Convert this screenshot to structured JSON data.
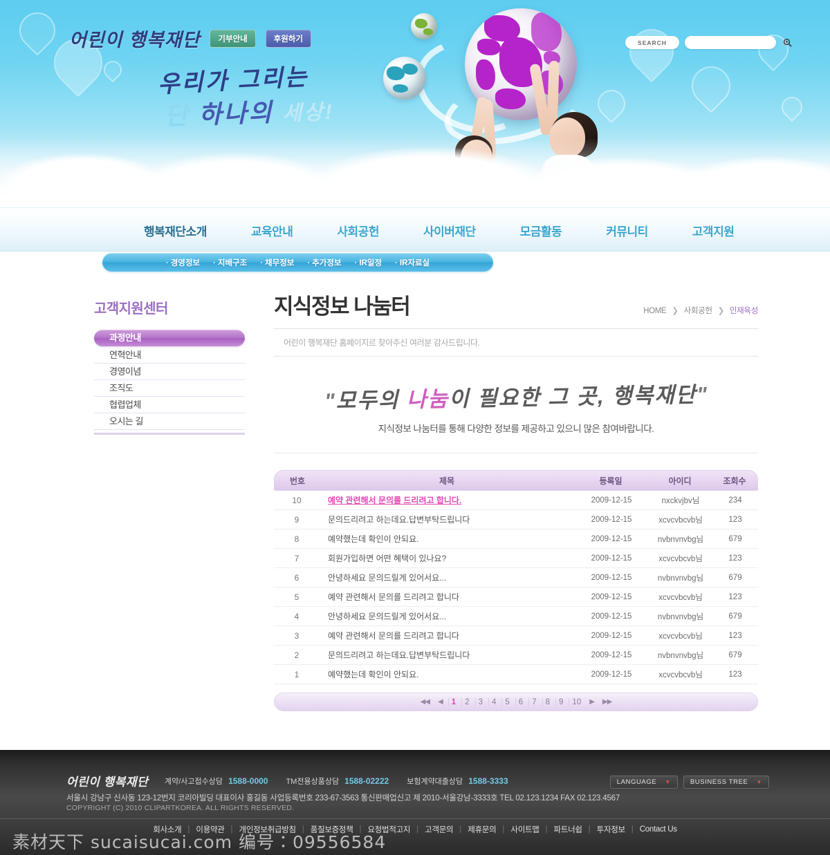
{
  "hero": {
    "logo": "어린이 행복재단",
    "buttons": [
      {
        "label": "기부안내",
        "color": "#3f9478"
      },
      {
        "label": "후원하기",
        "color": "#4a5cab"
      }
    ],
    "copy_line1": "우리가 그리는",
    "copy_line2_start": "단",
    "copy_line2_mid": "하나의",
    "copy_line2_end": "세상!",
    "search_label": "SEARCH",
    "search_value": "",
    "search_placeholder": "",
    "search_icon": "search-icon"
  },
  "nav": {
    "items": [
      {
        "label": "행복재단소개",
        "active": true
      },
      {
        "label": "교육안내",
        "active": false
      },
      {
        "label": "사회공헌",
        "active": false
      },
      {
        "label": "사이버재단",
        "active": false
      },
      {
        "label": "모금활동",
        "active": false
      },
      {
        "label": "커뮤니티",
        "active": false
      },
      {
        "label": "고객지원",
        "active": false
      }
    ]
  },
  "subnav": {
    "items": [
      "경영정보",
      "지배구조",
      "채무정보",
      "추가정보",
      "IR일정",
      "IR자료실"
    ]
  },
  "sidebar": {
    "title": "고객지원센터",
    "items": [
      {
        "label": "과정안내",
        "active": true
      },
      {
        "label": "연혁안내",
        "active": false
      },
      {
        "label": "경영이념",
        "active": false
      },
      {
        "label": "조직도",
        "active": false
      },
      {
        "label": "협렵업체",
        "active": false
      },
      {
        "label": "오시는 길",
        "active": false
      }
    ]
  },
  "main": {
    "page_title": "지식정보 나눔터",
    "breadcrumb": {
      "home": "HOME",
      "level1": "사회공헌",
      "current": "인재육성"
    },
    "subtitle": "어린이 행복재단 홈페이지르 찾아주신 여러분 감사드립니다.",
    "calligraphy": {
      "open_quote": "\"",
      "part1": "모두의",
      "highlight": "나눔",
      "part2": "이 필요한 그 곳, 행복재단",
      "close_quote": "\"",
      "highlight_color": "#cf5fc0"
    },
    "calligraphy_sub": "지식정보 나눔터를 통해 다양한 정보를 제공하고 있으니 많은 참여바랍니다."
  },
  "board": {
    "columns": [
      "번호",
      "제목",
      "등록일",
      "아이디",
      "조회수"
    ],
    "rows": [
      {
        "no": "10",
        "title": "예약 관련해서 문의를 드리려고 합니다.",
        "date": "2009-12-15",
        "id": "nxckvjbv님",
        "hits": "234",
        "hot": true
      },
      {
        "no": "9",
        "title": "문의드리려고 하는데요.답변부탁드립니다",
        "date": "2009-12-15",
        "id": "xcvcvbcvb님",
        "hits": "123",
        "hot": false
      },
      {
        "no": "8",
        "title": "예약했는데 확인이 안되요.",
        "date": "2009-12-15",
        "id": "nvbnvnvbg님",
        "hits": "679",
        "hot": false
      },
      {
        "no": "7",
        "title": "회원가입하면 어떤 혜택이 있나요?",
        "date": "2009-12-15",
        "id": "xcvcvbcvb님",
        "hits": "123",
        "hot": false
      },
      {
        "no": "6",
        "title": "안녕하세요 문의드릴게 있어서요...",
        "date": "2009-12-15",
        "id": "nvbnvnvbg님",
        "hits": "679",
        "hot": false
      },
      {
        "no": "5",
        "title": "예약 관련해서 문의를 드리려고 합니다",
        "date": "2009-12-15",
        "id": "xcvcvbcvb님",
        "hits": "123",
        "hot": false
      },
      {
        "no": "4",
        "title": "안녕하세요 문의드릴게 있어서요...",
        "date": "2009-12-15",
        "id": "nvbnvnvbg님",
        "hits": "679",
        "hot": false
      },
      {
        "no": "3",
        "title": "예약 관련해서 문의를 드리려고 합니다",
        "date": "2009-12-15",
        "id": "xcvcvbcvb님",
        "hits": "123",
        "hot": false
      },
      {
        "no": "2",
        "title": "문의드리려고 하는데요.답변부탁드립니다",
        "date": "2009-12-15",
        "id": "nvbnvnvbg님",
        "hits": "679",
        "hot": false
      },
      {
        "no": "1",
        "title": "예약했는데 확인이 안되요.",
        "date": "2009-12-15",
        "id": "xcvcvbcvb님",
        "hits": "123",
        "hot": false
      }
    ]
  },
  "pagination": {
    "first": "◀◀",
    "prev": "◀",
    "pages": [
      "1",
      "2",
      "3",
      "4",
      "5",
      "6",
      "7",
      "8",
      "9",
      "10"
    ],
    "current": "1",
    "next": "▶",
    "last": "▶▶"
  },
  "footer": {
    "logo": "어린이 행복재단",
    "tels": [
      {
        "label": "계약/사고접수상담",
        "number": "1588-0000"
      },
      {
        "label": "TM전용상품상담",
        "number": "1588-02222"
      },
      {
        "label": "보험계약대출상담",
        "number": "1588-3333"
      }
    ],
    "address": "서울시 강남구 신사동 123-12번지 코리아빌딩  대표이사 홍길동 사업등록번호 233-67-3563 통신판매업신고 제 2010-서울강남-3333호  TEL 02.123.1234   FAX 02.123.4567",
    "copyright": "COPYRIGHT (C) 2010 CLIPARTKOREA. ALL RIGHTS RESERVED.",
    "selects": [
      {
        "label": "LANGUAGE"
      },
      {
        "label": "BUSINESS TREE"
      }
    ],
    "links": [
      "회사소개",
      "이용약관",
      "개인정보취급방침",
      "품질보증정책",
      "요청법적고지",
      "고객문의",
      "제휴문의",
      "사이트맵",
      "파트너쉽",
      "투자정보",
      "Contact Us"
    ]
  },
  "watermark": "素材天下 sucaisucai.com  编号：09556584"
}
